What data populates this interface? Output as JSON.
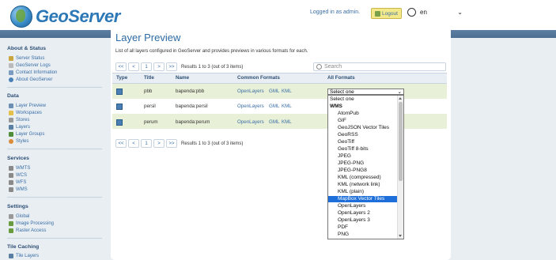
{
  "header": {
    "app_name": "GeoServer",
    "login_text": "Logged in as admin.",
    "logout_label": "Logout",
    "language": "en"
  },
  "sidebar": {
    "sections": [
      {
        "title": "About & Status",
        "items": [
          "Server Status",
          "GeoServer Logs",
          "Contact Information",
          "About GeoServer"
        ]
      },
      {
        "title": "Data",
        "items": [
          "Layer Preview",
          "Workspaces",
          "Stores",
          "Layers",
          "Layer Groups",
          "Styles"
        ]
      },
      {
        "title": "Services",
        "items": [
          "WMTS",
          "WCS",
          "WFS",
          "WMS"
        ]
      },
      {
        "title": "Settings",
        "items": [
          "Global",
          "Image Processing",
          "Raster Access"
        ]
      },
      {
        "title": "Tile Caching",
        "items": [
          "Tile Layers"
        ]
      }
    ]
  },
  "main": {
    "title": "Layer Preview",
    "description": "List of all layers configured in GeoServer and provides previews in various formats for each.",
    "pager": {
      "first": "<<",
      "prev": "<",
      "page": "1",
      "next": ">",
      "last": ">>",
      "results": "Results 1 to 3 (out of 3 items)"
    },
    "search_placeholder": "Search",
    "columns": [
      "Type",
      "Title",
      "Name",
      "Common Formats",
      "All Formats"
    ],
    "rows": [
      {
        "title": "pbb",
        "name": "bapenda:pbb",
        "common": [
          "OpenLayers",
          "GML",
          "KML"
        ],
        "all": "Select one"
      },
      {
        "title": "persil",
        "name": "bapenda:persil",
        "common": [
          "OpenLayers",
          "GML",
          "KML"
        ],
        "all": "Select one"
      },
      {
        "title": "perum",
        "name": "bapenda:perum",
        "common": [
          "OpenLayers",
          "GML",
          "KML"
        ],
        "all": "Select one"
      }
    ]
  },
  "dropdown": {
    "selected": "Select one",
    "options": [
      {
        "label": "Select one",
        "kind": "first"
      },
      {
        "label": "WMS",
        "kind": "group"
      },
      {
        "label": "AtomPub"
      },
      {
        "label": "GIF"
      },
      {
        "label": "GeoJSON Vector Tiles"
      },
      {
        "label": "GeoRSS"
      },
      {
        "label": "GeoTiff"
      },
      {
        "label": "GeoTiff 8-bits"
      },
      {
        "label": "JPEG"
      },
      {
        "label": "JPEG-PNG"
      },
      {
        "label": "JPEG-PNG8"
      },
      {
        "label": "KML (compressed)"
      },
      {
        "label": "KML (network link)"
      },
      {
        "label": "KML (plain)"
      },
      {
        "label": "MapBox Vector Tiles",
        "kind": "highlight"
      },
      {
        "label": "OpenLayers"
      },
      {
        "label": "OpenLayers 2"
      },
      {
        "label": "OpenLayers 3"
      },
      {
        "label": "PDF"
      },
      {
        "label": "PNG"
      }
    ]
  },
  "colors": {
    "accent": "#2c6ba5",
    "band": "#4d6f92",
    "highlight": "#1e6fd9",
    "row_alt": "#e9f0d8"
  }
}
